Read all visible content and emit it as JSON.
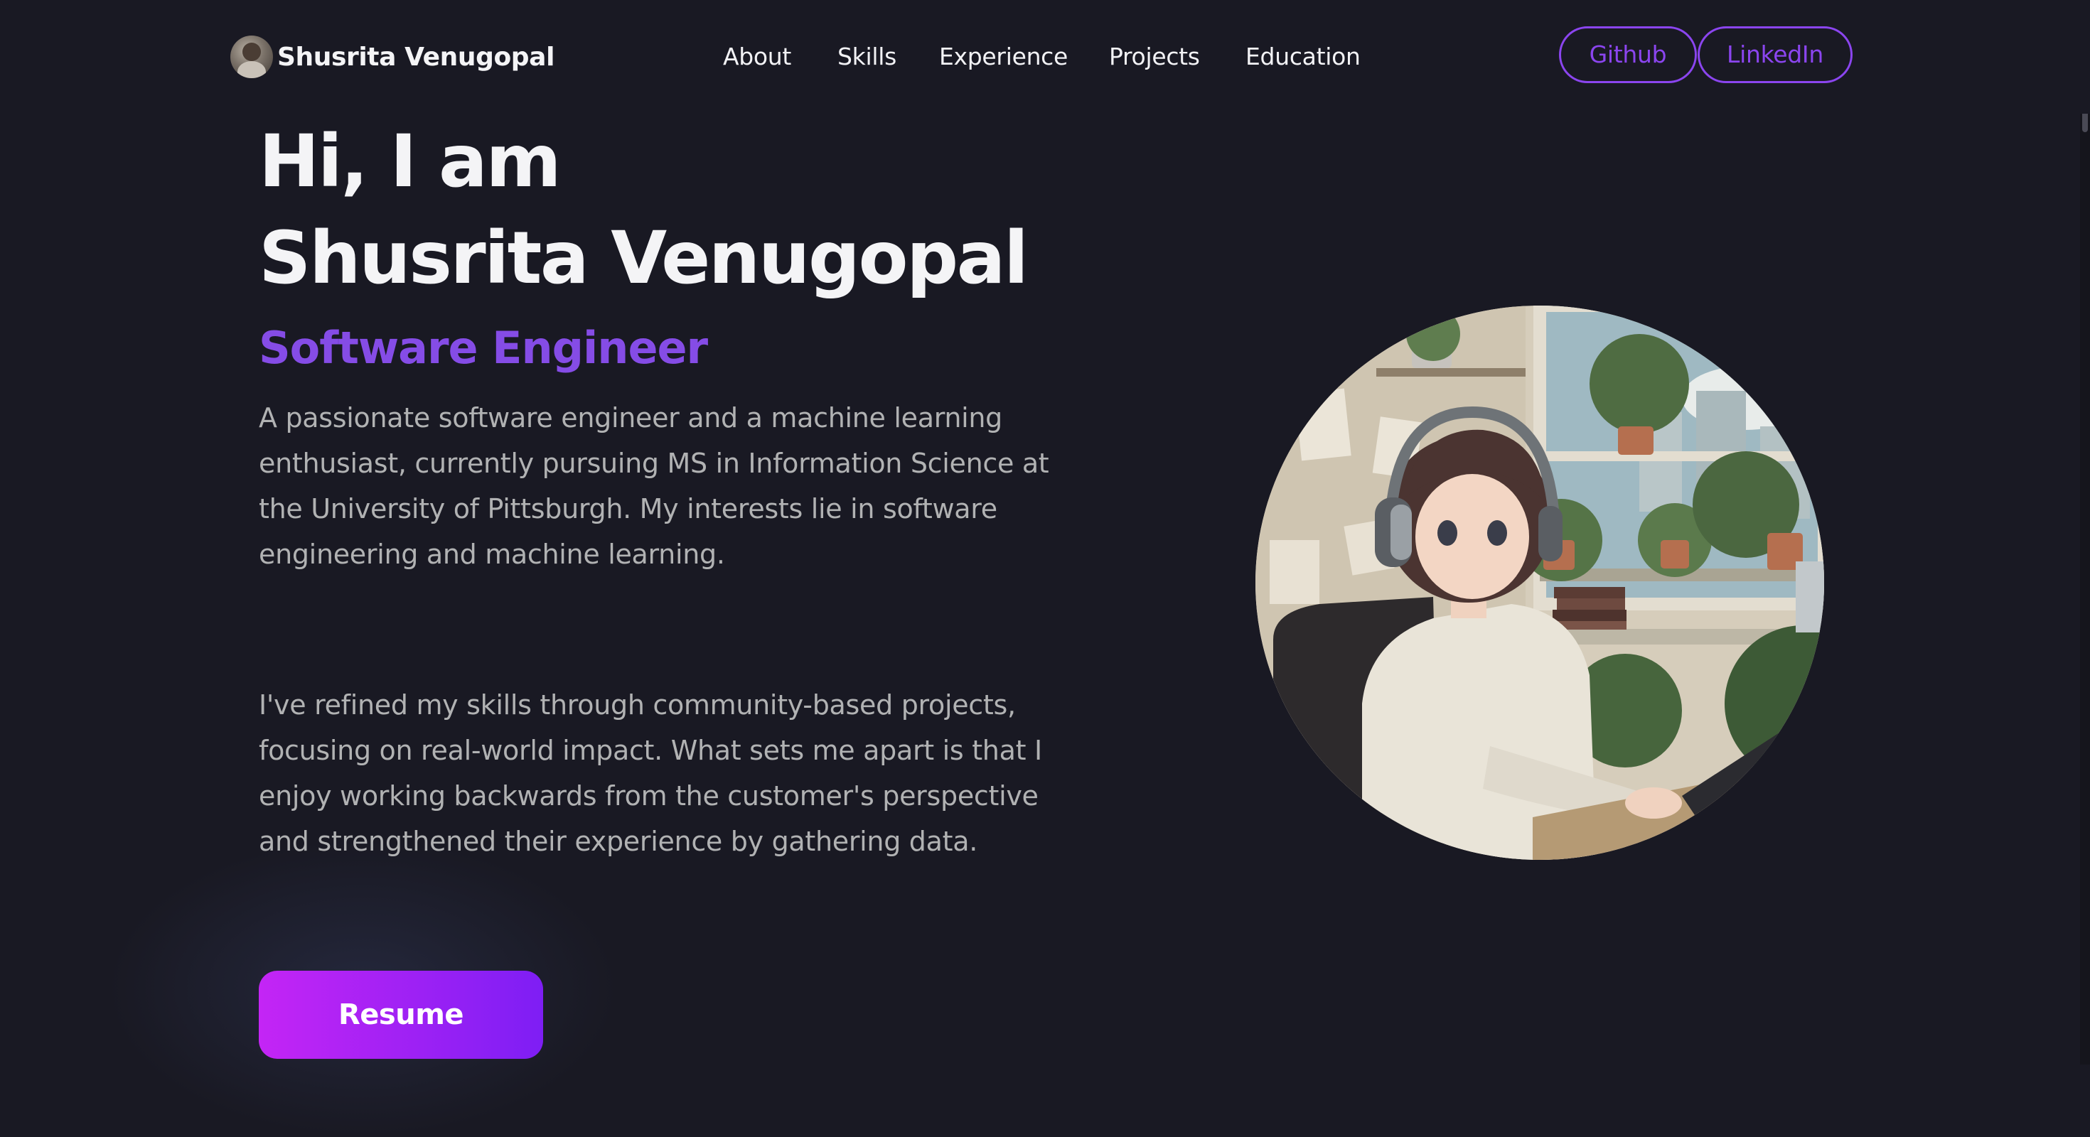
{
  "navbar": {
    "brand_name": "Shusrita Venugopal",
    "links": [
      "About",
      "Skills",
      "Experience",
      "Projects",
      "Education"
    ],
    "github_label": "Github",
    "linkedin_label": "LinkedIn"
  },
  "hero": {
    "greeting": "Hi, I am",
    "name": "Shusrita Venugopal",
    "role": "Software Engineer",
    "paragraph_1": "A passionate software engineer and a machine learning enthusiast, currently pursuing MS in Information Science at the University of Pittsburgh. My interests lie in software engineering and machine learning.",
    "paragraph_2": "I've refined my skills through community-based projects, focusing on real-world impact. What sets me apart is that I enjoy working backwards from the customer's perspective and strengthened their experience by gathering data.",
    "resume_label": "Resume"
  },
  "colors": {
    "background": "#191923",
    "accent": "#854ce6",
    "button_gradient_start": "#c425f5",
    "button_gradient_end": "#7e1ef4",
    "text_primary": "#f4f4f6",
    "text_secondary": "#b1b2b3"
  },
  "icons": {
    "brand_avatar": "profile-photo",
    "hero_image": "anime-girl-with-headphones-at-desk-illustration"
  }
}
